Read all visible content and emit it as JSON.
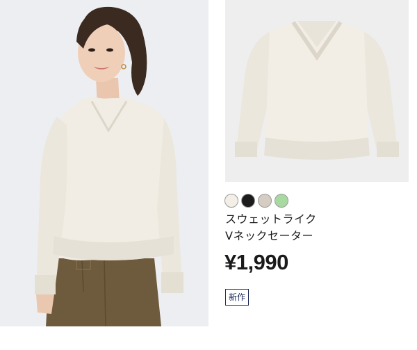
{
  "product": {
    "name_line1": "スウェットライク",
    "name_line2": "Vネックセーター",
    "price": "¥1,990",
    "badge": "新作",
    "colors": [
      {
        "name": "off-white",
        "hex": "#f3efe7"
      },
      {
        "name": "black",
        "hex": "#1c1c1c"
      },
      {
        "name": "beige",
        "hex": "#d6cdc2"
      },
      {
        "name": "green",
        "hex": "#a7d9a1"
      }
    ]
  },
  "colors": {
    "sweater": "#f1ede4",
    "pants": "#6e5a3c",
    "hair": "#3b2a20",
    "badge_border": "#1e2a5a"
  }
}
